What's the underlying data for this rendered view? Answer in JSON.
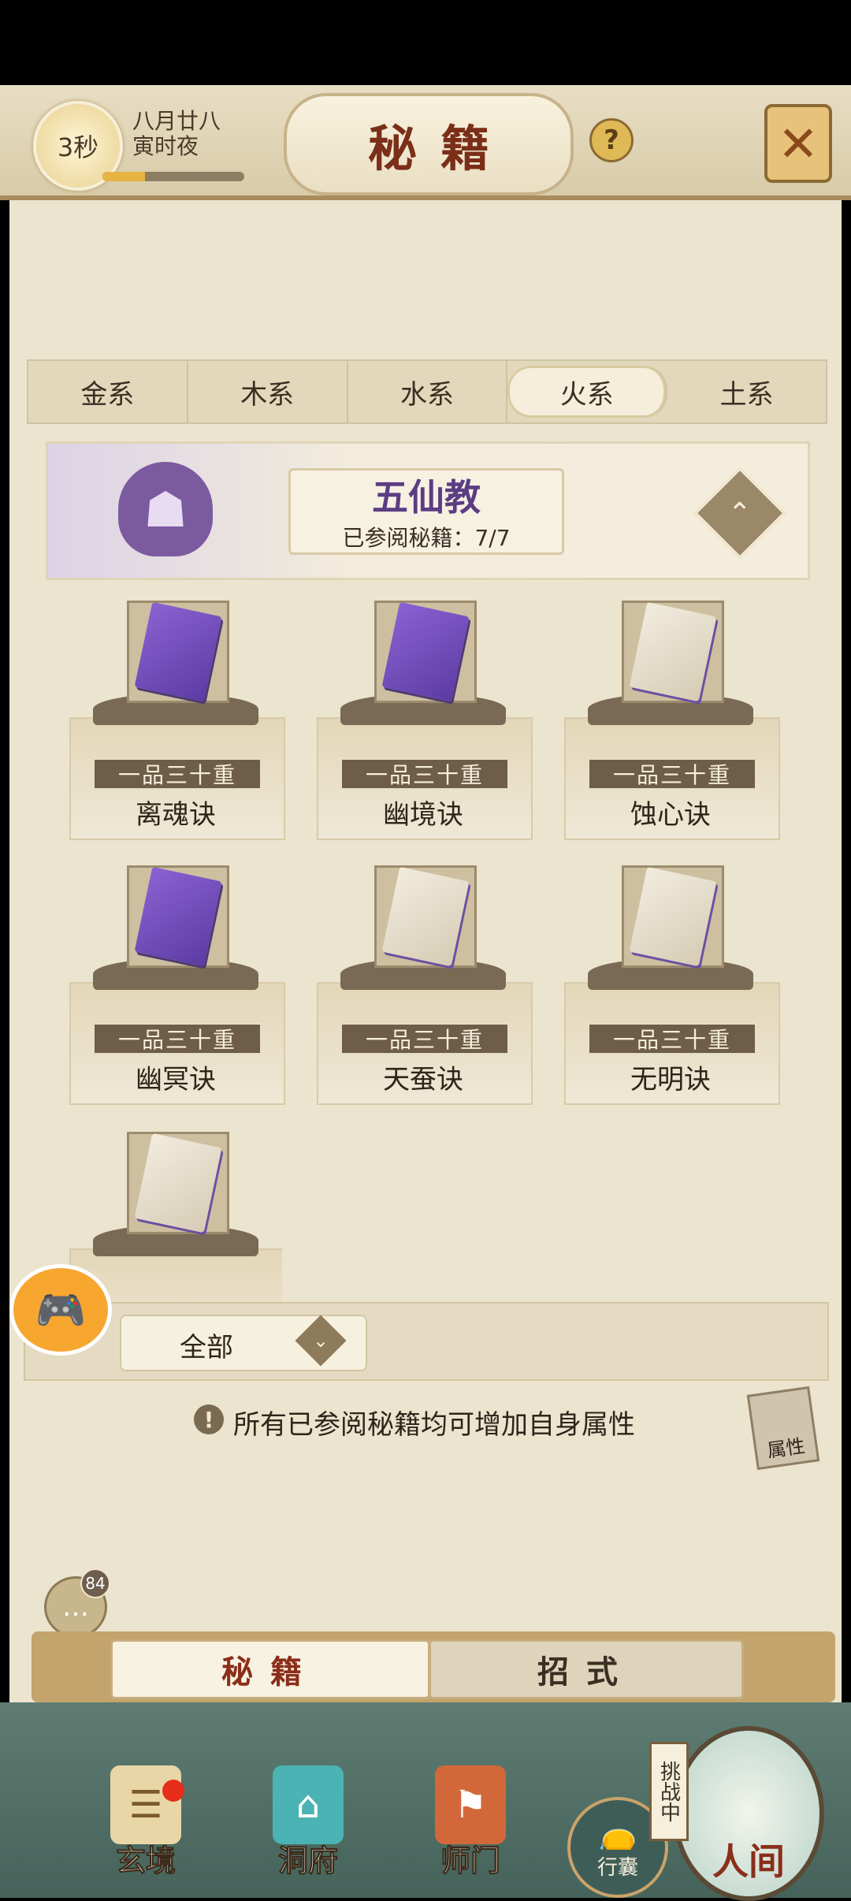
{
  "header": {
    "timer": "3秒",
    "date_line1": "八月廿八",
    "date_line2": "寅时夜",
    "time_progress": 0.3,
    "title": "秘籍",
    "help_icon": "question-icon",
    "close_icon": "close-cross-icon"
  },
  "tabs": [
    {
      "label": "金系"
    },
    {
      "label": "木系"
    },
    {
      "label": "水系"
    },
    {
      "label": "火系",
      "active": true
    },
    {
      "label": "土系"
    }
  ],
  "sect": {
    "name": "五仙教",
    "progress_text": "已参阅秘籍：7/7",
    "emblem_icon": "purple-beast-mask-icon"
  },
  "books": [
    {
      "grade": "一品三十重",
      "name": "离魂诀",
      "style": "purple"
    },
    {
      "grade": "一品三十重",
      "name": "幽境诀",
      "style": "purple"
    },
    {
      "grade": "一品三十重",
      "name": "蚀心诀",
      "style": "paper"
    },
    {
      "grade": "一品三十重",
      "name": "幽冥诀",
      "style": "purple"
    },
    {
      "grade": "一品三十重",
      "name": "天蚕诀",
      "style": "paper"
    },
    {
      "grade": "一品三十重",
      "name": "无明诀",
      "style": "paper"
    },
    {
      "grade": "",
      "name": "",
      "style": "paper"
    }
  ],
  "filter": {
    "label": "全部"
  },
  "hint": "所有已参阅秘籍均可增加自身属性",
  "attr_button": "属性",
  "chat": {
    "badge": "84"
  },
  "segments": {
    "left": "秘籍",
    "right": "招式"
  },
  "nav": {
    "item1": "玄境",
    "item2": "洞府",
    "item3": "师门",
    "bag": "行囊",
    "challenge": "挑战中",
    "world": "人间"
  },
  "colors": {
    "accent_red": "#7b2e18",
    "sect_purple": "#5b3d83",
    "panel_bg": "#ebe4cf"
  }
}
